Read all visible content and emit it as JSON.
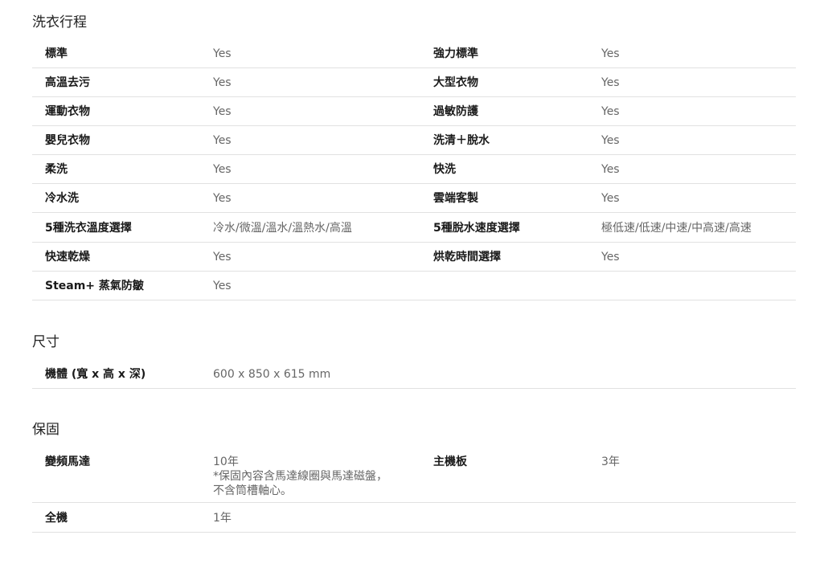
{
  "sections": {
    "programs": {
      "title": "洗衣行程",
      "rows": [
        {
          "l1": "標準",
          "v1": "Yes",
          "l2": "強力標準",
          "v2": "Yes"
        },
        {
          "l1": "高溫去污",
          "v1": "Yes",
          "l2": "大型衣物",
          "v2": "Yes"
        },
        {
          "l1": "運動衣物",
          "v1": "Yes",
          "l2": "過敏防護",
          "v2": "Yes"
        },
        {
          "l1": "嬰兒衣物",
          "v1": "Yes",
          "l2": "洗清＋脫水",
          "v2": "Yes"
        },
        {
          "l1": "柔洗",
          "v1": "Yes",
          "l2": "快洗",
          "v2": "Yes"
        },
        {
          "l1": "冷水洗",
          "v1": "Yes",
          "l2": "雲端客製",
          "v2": "Yes"
        },
        {
          "l1": "5種洗衣溫度選擇",
          "v1": "冷水/微溫/溫水/溫熱水/高溫",
          "l2": "5種脫水速度選擇",
          "v2": "極低速/低速/中速/中高速/高速"
        },
        {
          "l1": "快速乾燥",
          "v1": "Yes",
          "l2": "烘乾時間選擇",
          "v2": "Yes"
        },
        {
          "l1": "Steam+ 蒸氣防皺",
          "v1": "Yes"
        }
      ]
    },
    "dimensions": {
      "title": "尺寸",
      "rows": [
        {
          "l1": "機體 (寬 x 高 x 深)",
          "v1": "600 x 850 x 615 mm"
        }
      ]
    },
    "warranty": {
      "title": "保固",
      "rows": [
        {
          "l1": "變頻馬達",
          "v1_lines": [
            "10年",
            "*保固內容含馬達線圈與馬達磁盤，",
            "不含筒槽軸心。"
          ],
          "l2": "主機板",
          "v2": "3年"
        },
        {
          "l1": "全機",
          "v1": "1年"
        }
      ]
    }
  }
}
